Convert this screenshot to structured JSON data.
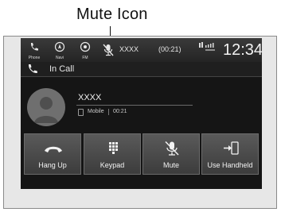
{
  "annotation": {
    "label": "Mute Icon"
  },
  "statusbar": {
    "items": [
      {
        "icon": "phone-icon",
        "label": "Phone"
      },
      {
        "icon": "navi-icon",
        "label": "Navi"
      },
      {
        "icon": "fm-radio-icon",
        "label": "FM"
      }
    ],
    "mute_icon": "mute-icon",
    "caller_name": "XXXX",
    "call_duration": "(00:21)",
    "clock": "12:34"
  },
  "call_header": {
    "label": "In Call"
  },
  "caller": {
    "name": "XXXX",
    "type": "Mobile",
    "duration": "00:21"
  },
  "buttons": [
    {
      "icon": "hang-up-icon",
      "label": "Hang Up"
    },
    {
      "icon": "keypad-icon",
      "label": "Keypad"
    },
    {
      "icon": "mute-icon",
      "label": "Mute"
    },
    {
      "icon": "handheld-transfer-icon",
      "label": "Use Handheld"
    }
  ]
}
